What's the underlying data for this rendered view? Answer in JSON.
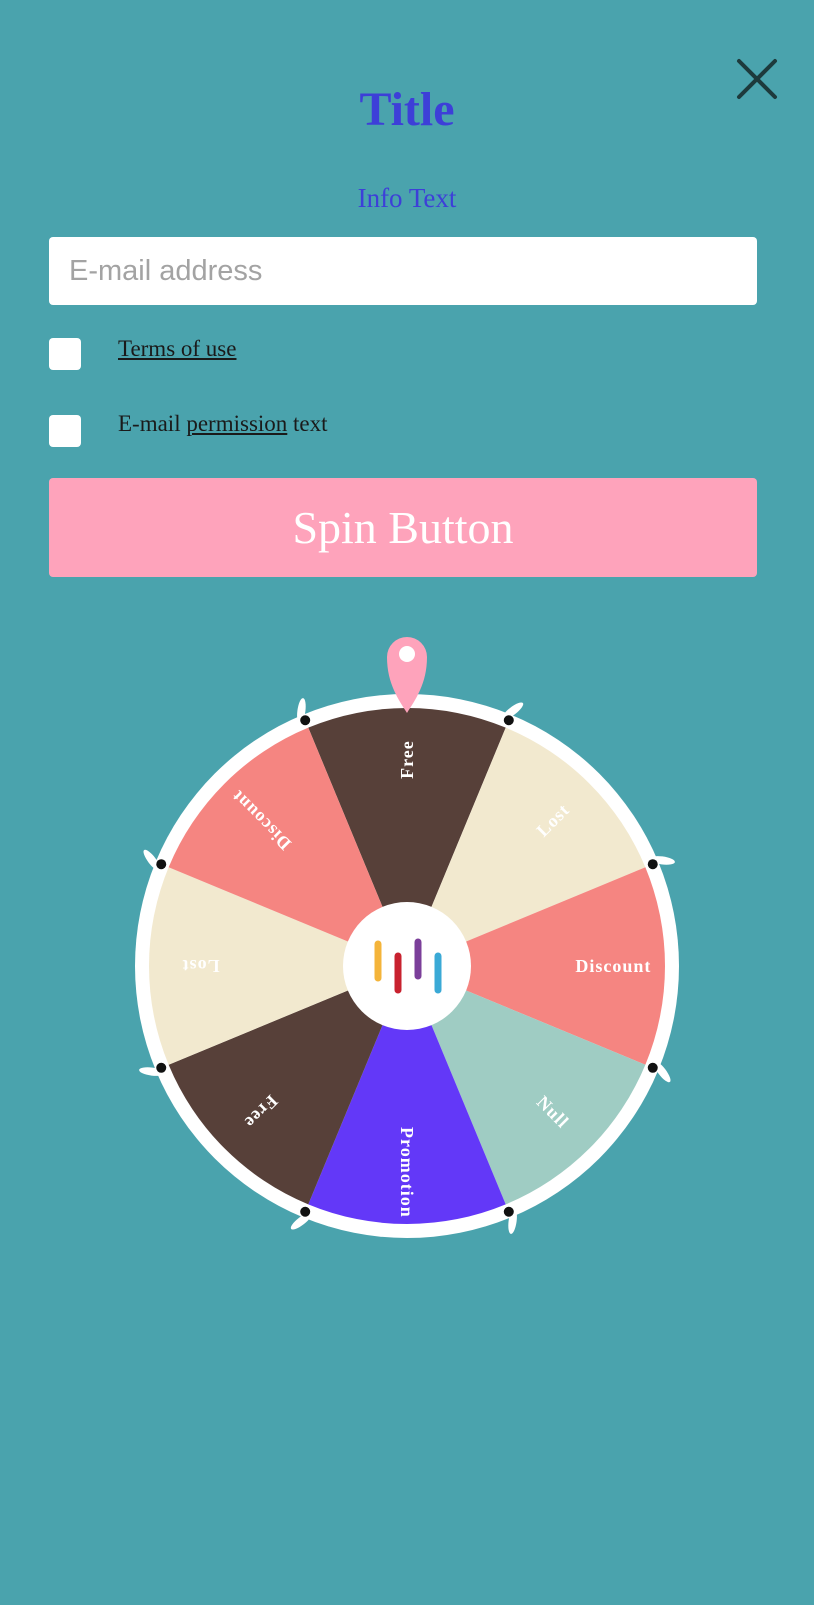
{
  "header": {
    "close_icon": "close-icon",
    "title": "Title",
    "info_text": "Info Text"
  },
  "form": {
    "email_placeholder": "E-mail address",
    "email_value": "",
    "terms_checkbox_checked": false,
    "terms_link": "Terms of use",
    "permission_checkbox_checked": false,
    "permission_prefix": "E-mail ",
    "permission_link": "permission",
    "permission_suffix": " text",
    "spin_button": "Spin Button"
  },
  "wheel": {
    "pointer_icon": "map-pin-icon",
    "center_logo_icon": "bars-logo-icon",
    "segments": [
      {
        "label": "Free",
        "color": "#574039",
        "text_color": "#ffffff"
      },
      {
        "label": "Lost",
        "color": "#f2e9cf",
        "text_color": "#ffffff"
      },
      {
        "label": "Discount",
        "color": "#f58581",
        "text_color": "#ffffff"
      },
      {
        "label": "Null",
        "color": "#9fccc3",
        "text_color": "#ffffff"
      },
      {
        "label": "Promotion",
        "color": "#6338f8",
        "text_color": "#ffffff"
      },
      {
        "label": "Free",
        "color": "#574039",
        "text_color": "#ffffff"
      },
      {
        "label": "Lost",
        "color": "#f2e9cf",
        "text_color": "#ffffff"
      },
      {
        "label": "Discount",
        "color": "#f58581",
        "text_color": "#ffffff"
      }
    ]
  },
  "colors": {
    "background": "#4aa3ad",
    "title": "#3d3fd8",
    "accent": "#fea3bb",
    "wheel_rim": "#ffffff",
    "logo_bars": [
      "#f4b43a",
      "#c8222f",
      "#7b3f9a",
      "#3aa9d6"
    ]
  }
}
